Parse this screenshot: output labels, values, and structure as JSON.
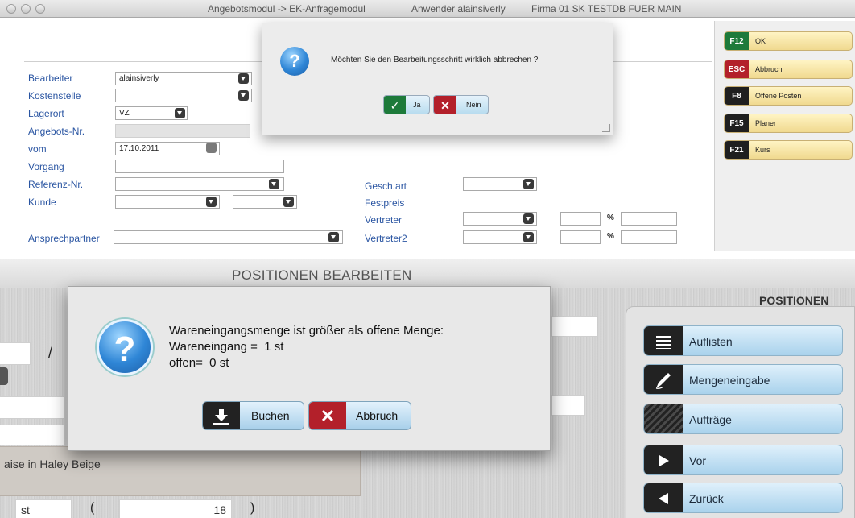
{
  "top_window": {
    "title_module": "Angebotsmodul -> EK-Anfragemodul",
    "title_user": "Anwender alainsiverly",
    "title_company": "Firma 01 SK TESTDB FUER MAIN",
    "form": {
      "bearbeiter_label": "Bearbeiter",
      "bearbeiter_value": "alainsiverly",
      "kostenstelle_label": "Kostenstelle",
      "lagerort_label": "Lagerort",
      "lagerort_value": "VZ",
      "angebotsnr_label": "Angebots-Nr.",
      "vom_label": "vom",
      "vom_value": "17.10.2011",
      "vorgang_label": "Vorgang",
      "referenz_label": "Referenz-Nr.",
      "kunde_label": "Kunde",
      "ansprechpartner_label": "Ansprechpartner",
      "geschart_label": "Gesch.art",
      "festpreis_label": "Festpreis",
      "vertreter_label": "Vertreter",
      "vertreter2_label": "Vertreter2",
      "percent_sign": "%"
    },
    "dialog": {
      "message": "Möchten Sie den Bearbeitungsschritt wirklich abbrechen ?",
      "yes_label": "Ja",
      "no_label": "Nein",
      "question_mark": "?"
    },
    "function_keys": [
      {
        "key": "F12",
        "label": "OK",
        "color": "#1d7a3a"
      },
      {
        "key": "ESC",
        "label": "Abbruch",
        "color": "#b3202a"
      },
      {
        "key": "F8",
        "label": "Offene Posten",
        "color": "#1f1f1f"
      },
      {
        "key": "F15",
        "label": "Planer",
        "color": "#1f1f1f"
      },
      {
        "key": "F21",
        "label": "Kurs",
        "color": "#1f1f1f"
      }
    ]
  },
  "bottom_window": {
    "title": "POSITIONEN BEARBEITEN",
    "positions_title": "POSITIONEN",
    "slash": "/",
    "paren_open": "(",
    "paren_close": ")",
    "unit_value": "st",
    "qty_value": "18",
    "article_text": "aise in Haley Beige",
    "dialog": {
      "line1": "Wareneingangsmenge ist größer als offene Menge:",
      "line2": "Wareneingang =  1 st",
      "line3": "offen=  0 st",
      "book_label": "Buchen",
      "cancel_label": "Abbruch",
      "question_mark": "?"
    },
    "buttons": [
      {
        "label": "Auflisten",
        "icon": "list-icon"
      },
      {
        "label": "Mengeneingabe",
        "icon": "pen-icon"
      },
      {
        "label": "Aufträge",
        "icon": "hatch-icon"
      },
      {
        "label": "Vor",
        "icon": "play-right-icon"
      },
      {
        "label": "Zurück",
        "icon": "play-left-icon"
      }
    ]
  }
}
